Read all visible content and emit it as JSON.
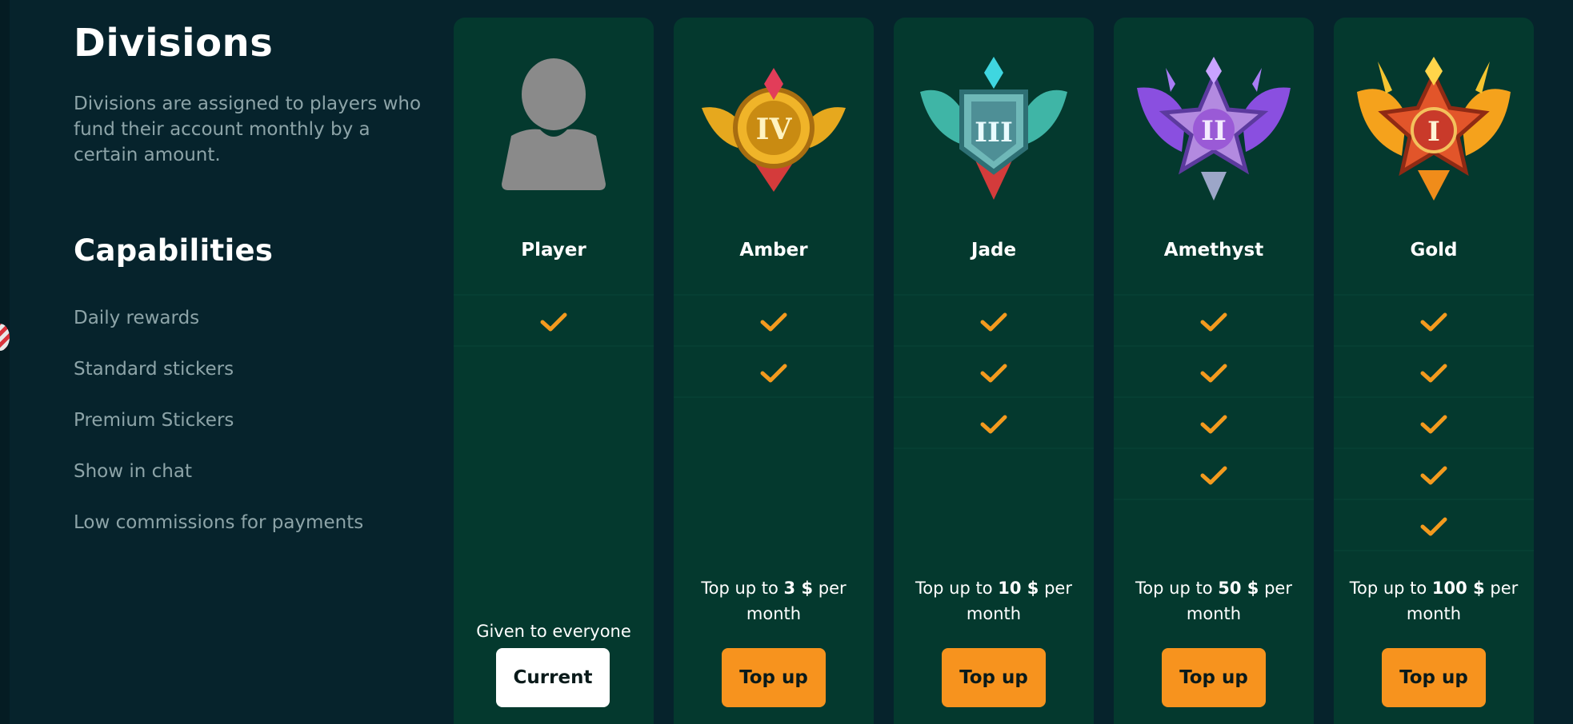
{
  "header": {
    "title": "Divisions",
    "description": "Divisions are assigned to players who fund their account monthly by a certain amount."
  },
  "capabilities": {
    "title": "Capabilities",
    "items": [
      "Daily rewards",
      "Standard stickers",
      "Premium Stickers",
      "Show in chat",
      "Low commissions for payments"
    ]
  },
  "divisions": [
    {
      "name": "Player",
      "badge": "avatar-icon",
      "features": [
        true,
        false,
        false,
        false,
        false
      ],
      "note_text": "Given to everyone",
      "button": "Current"
    },
    {
      "name": "Amber",
      "badge": "amber-rank-iv-badge",
      "numeral": "IV",
      "features": [
        true,
        true,
        false,
        false,
        false
      ],
      "note_pre": "Top up to ",
      "note_amount": "3 $",
      "note_post": " per month",
      "button": "Top up"
    },
    {
      "name": "Jade",
      "badge": "jade-rank-iii-badge",
      "numeral": "III",
      "features": [
        true,
        true,
        true,
        false,
        false
      ],
      "note_pre": "Top up to ",
      "note_amount": "10 $",
      "note_post": " per month",
      "button": "Top up"
    },
    {
      "name": "Amethyst",
      "badge": "amethyst-rank-ii-badge",
      "numeral": "II",
      "features": [
        true,
        true,
        true,
        true,
        false
      ],
      "note_pre": "Top up to ",
      "note_amount": "50 $",
      "note_post": " per month",
      "button": "Top up"
    },
    {
      "name": "Gold",
      "badge": "gold-rank-i-badge",
      "numeral": "I",
      "features": [
        true,
        true,
        true,
        true,
        true
      ],
      "note_pre": "Top up to ",
      "note_amount": "100 $",
      "note_post": " per month",
      "button": "Top up"
    }
  ],
  "colors": {
    "background": "#06232c",
    "card": "#04392e",
    "accent": "#f7931e",
    "check": "#f39a1e",
    "muted_text": "#8da4a8"
  }
}
